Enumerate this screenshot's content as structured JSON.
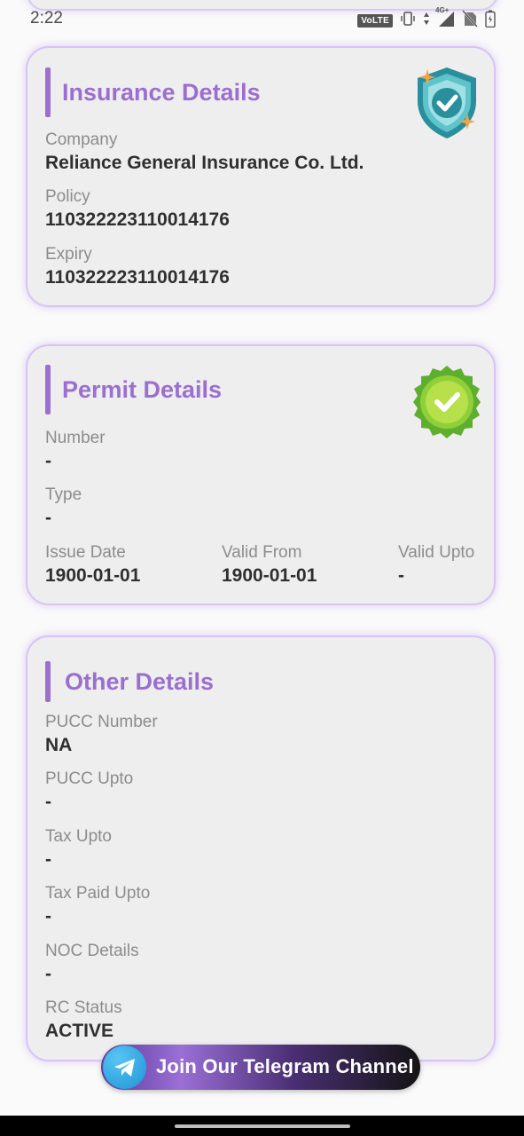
{
  "status_bar": {
    "time": "2:22",
    "volte": "VoLTE",
    "network": "4G+",
    "icons": [
      "vibrate-icon",
      "data-arrows-icon",
      "signal-icon",
      "no-sim-icon",
      "battery-icon"
    ]
  },
  "insurance": {
    "title": "Insurance Details",
    "badge_icon": "shield-check-icon",
    "company_label": "Company",
    "company_value": "Reliance General Insurance Co. Ltd.",
    "policy_label": "Policy",
    "policy_value": "110322223110014176",
    "expiry_label": "Expiry",
    "expiry_value": "110322223110014176"
  },
  "permit": {
    "title": "Permit Details",
    "badge_icon": "verified-badge-icon",
    "number_label": "Number",
    "number_value": "-",
    "type_label": "Type",
    "type_value": "-",
    "issue_label": "Issue Date",
    "issue_value": "1900-01-01",
    "valid_from_label": "Valid From",
    "valid_from_value": "1900-01-01",
    "valid_upto_label": "Valid Upto",
    "valid_upto_value": "-"
  },
  "other": {
    "title": "Other Details",
    "pucc_number_label": "PUCC Number",
    "pucc_number_value": "NA",
    "pucc_upto_label": "PUCC Upto",
    "pucc_upto_value": "-",
    "tax_upto_label": "Tax Upto",
    "tax_upto_value": "-",
    "tax_paid_label": "Tax Paid Upto",
    "tax_paid_value": "-",
    "noc_label": "NOC Details",
    "noc_value": "-",
    "rc_status_label": "RC Status",
    "rc_status_value": "ACTIVE"
  },
  "telegram": {
    "label": "Join Our Telegram Channel",
    "icon": "telegram-icon"
  },
  "colors": {
    "accent": "#9a6fcf",
    "card_bg": "#eeeeee",
    "card_border": "#d6c4f3",
    "telegram_blue": "#1d95d6"
  }
}
